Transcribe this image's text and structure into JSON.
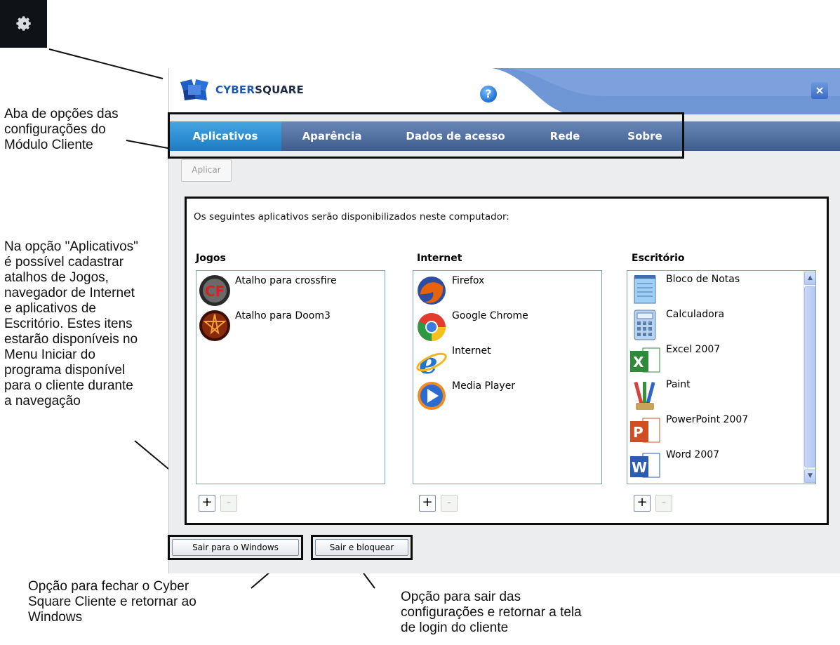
{
  "annotations": {
    "tabs_note": "Aba de opções das\nconfigurações do\nMódulo Cliente",
    "apps_note": "Na opção \"Aplicativos\"\né possível cadastrar\natalhos de Jogos,\nnavegador de Internet\ne aplicativos de\nEscritório. Estes itens\nestarão disponíveis no\nMenu Iniciar do\nprograma disponível\npara o cliente durante\na navegação",
    "exit_windows_note": "Opção para fechar o Cyber\nSquare Cliente e retornar ao\nWindows",
    "exit_lock_note": "Opção para sair das\nconfigurações e retornar a tela\nde login do cliente"
  },
  "window": {
    "brand_part1": "CYBER",
    "brand_part2": "SQUARE",
    "help": "?",
    "close": "×",
    "tabs": [
      "Aplicativos",
      "Aparência",
      "Dados de acesso",
      "Rede",
      "Sobre"
    ],
    "apply_button": "Aplicar",
    "description": "Os seguintes aplicativos serão disponibilizados neste computador:",
    "columns": [
      {
        "title": "Jogos",
        "items": [
          "Atalho para crossfire",
          "Atalho para Doom3"
        ]
      },
      {
        "title": "Internet",
        "items": [
          "Firefox",
          "Google Chrome",
          "Internet",
          "Media Player"
        ]
      },
      {
        "title": "Escritório",
        "items": [
          "Bloco de Notas",
          "Calculadora",
          "Excel 2007",
          "Paint",
          "PowerPoint 2007",
          "Word 2007"
        ]
      }
    ],
    "add": "+",
    "remove": "-",
    "exit_windows": "Sair para o Windows",
    "exit_lock": "Sair e bloquear"
  }
}
